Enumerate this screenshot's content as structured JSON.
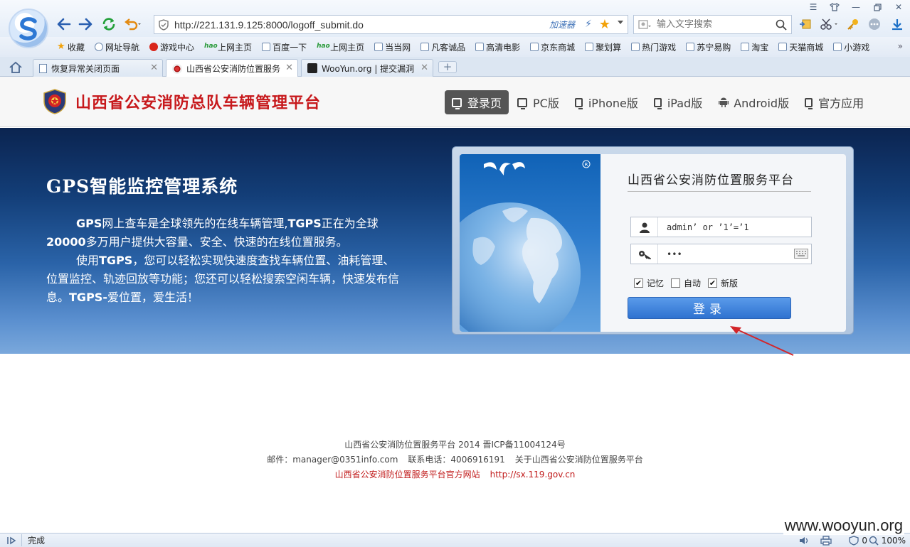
{
  "browser": {
    "url": "http://221.131.9.125:8000/logoff_submit.do",
    "accelerator_label": "加速器",
    "search_placeholder": "输入文字搜索",
    "bookmarks": [
      {
        "label": "收藏",
        "icon": "star"
      },
      {
        "label": "网址导航",
        "icon": "globe"
      },
      {
        "label": "游戏中心",
        "icon": "red"
      },
      {
        "label": "上网主页",
        "icon": "hao"
      },
      {
        "label": "百度一下",
        "icon": "page"
      },
      {
        "label": "上网主页",
        "icon": "hao"
      },
      {
        "label": "当当网",
        "icon": "page"
      },
      {
        "label": "凡客诚品",
        "icon": "page"
      },
      {
        "label": "高清电影",
        "icon": "page"
      },
      {
        "label": "京东商城",
        "icon": "page"
      },
      {
        "label": "聚划算",
        "icon": "page"
      },
      {
        "label": "热门游戏",
        "icon": "page"
      },
      {
        "label": "苏宁易购",
        "icon": "page"
      },
      {
        "label": "淘宝",
        "icon": "page"
      },
      {
        "label": "天猫商城",
        "icon": "page"
      },
      {
        "label": "小游戏",
        "icon": "page"
      }
    ],
    "tabs": [
      {
        "label": "恢复异常关闭页面",
        "active": false
      },
      {
        "label": "山西省公安消防位置服务",
        "active": true
      },
      {
        "label": "WooYun.org | 提交漏洞",
        "active": false
      }
    ],
    "status": "完成",
    "status_right": {
      "count": "0",
      "zoom": "100%"
    }
  },
  "header": {
    "brand_title": "山西省公安消防总队车辆管理平台",
    "nav": [
      {
        "label": "登录页",
        "active": true
      },
      {
        "label": "PC版",
        "active": false
      },
      {
        "label": "iPhone版",
        "active": false
      },
      {
        "label": "iPad版",
        "active": false
      },
      {
        "label": "Android版",
        "active": false
      },
      {
        "label": "官方应用",
        "active": false
      }
    ]
  },
  "hero": {
    "title": "GPS智能监控管理系统",
    "para1_a": "GPS",
    "para1_b": "网上查车是全球领先的在线车辆管理,",
    "para1_c": "TGPS",
    "para1_d": "正在为全球",
    "para1_e": "20000",
    "para1_f": "多万用户提供大容量、安全、快速的在线位置服务。",
    "para2_a": "使用",
    "para2_b": "TGPS",
    "para2_c": "，您可以轻松实现快速度查找车辆位置、油耗管理、位置监控、轨迹回放等功能；您还可以轻松搜索空闲车辆，快速发布信息。",
    "para2_d": "TGPS-",
    "para2_e": "爱位置，爱生活！"
  },
  "login": {
    "title": "山西省公安消防位置服务平台",
    "username_value": "admin’ or ’1’=’1",
    "password_value": "•••",
    "remember_label": "记忆",
    "remember_checked": true,
    "auto_label": "自动",
    "auto_checked": false,
    "newver_label": "新版",
    "newver_checked": true,
    "submit_label": "登录"
  },
  "footer": {
    "line1": "山西省公安消防位置服务平台 2014 晋ICP备11004124号",
    "email": "邮件：manager@0351info.com",
    "phone": "联系电话：4006916191",
    "about": "关于山西省公安消防位置服务平台",
    "official_site_label": "山西省公安消防位置服务平台官方网站",
    "official_site_url": "http://sx.119.gov.cn"
  },
  "watermark": "www.wooyun.org",
  "colors": {
    "brand_red": "#c7191c",
    "hero_blue": "#133e78",
    "button_blue": "#3a7fd8",
    "arrow_red": "#d3262a"
  }
}
